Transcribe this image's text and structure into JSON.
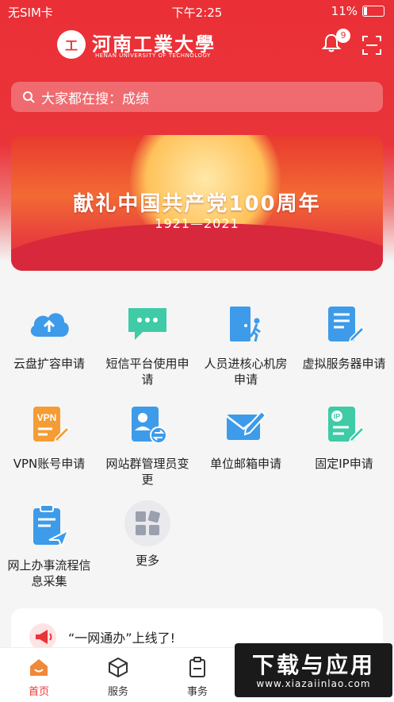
{
  "status": {
    "carrier": "无SIM卡",
    "time": "下午2:25",
    "battery": "11%"
  },
  "header": {
    "school_name": "河南工業大學",
    "school_en": "HENAN UNIVERSITY OF TECHNOLOGY",
    "notification_count": "9"
  },
  "search": {
    "placeholder": "大家都在搜：成绩"
  },
  "banner": {
    "title": "献礼中国共产党100周年",
    "years": "1921—2021"
  },
  "apps": [
    {
      "label": "云盘扩容申请",
      "icon": "cloud-upload-icon"
    },
    {
      "label": "短信平台使用申请",
      "icon": "chat-bubble-icon"
    },
    {
      "label": "人员进核心机房申请",
      "icon": "door-walk-icon"
    },
    {
      "label": "虚拟服务器申请",
      "icon": "server-form-icon"
    },
    {
      "label": "VPN账号申请",
      "icon": "vpn-doc-icon"
    },
    {
      "label": "网站群管理员变更",
      "icon": "admin-switch-icon"
    },
    {
      "label": "单位邮箱申请",
      "icon": "mail-edit-icon"
    },
    {
      "label": "固定IP申请",
      "icon": "ip-doc-icon"
    },
    {
      "label": "网上办事流程信息采集",
      "icon": "clipboard-send-icon"
    },
    {
      "label": "更多",
      "icon": "more-grid-icon"
    }
  ],
  "notice": {
    "text": "“一网通办”上线了!"
  },
  "tabs": [
    {
      "label": "首页",
      "icon": "home-icon"
    },
    {
      "label": "服务",
      "icon": "cube-icon"
    },
    {
      "label": "事务",
      "icon": "clipboard-icon"
    }
  ],
  "watermark": {
    "title": "下载与应用",
    "url": "www.xiazaiinlao.com"
  },
  "colors": {
    "brand_red": "#e9343a",
    "icon_blue": "#3d9be9",
    "icon_green": "#3ecba6",
    "icon_orange": "#f59c35"
  }
}
